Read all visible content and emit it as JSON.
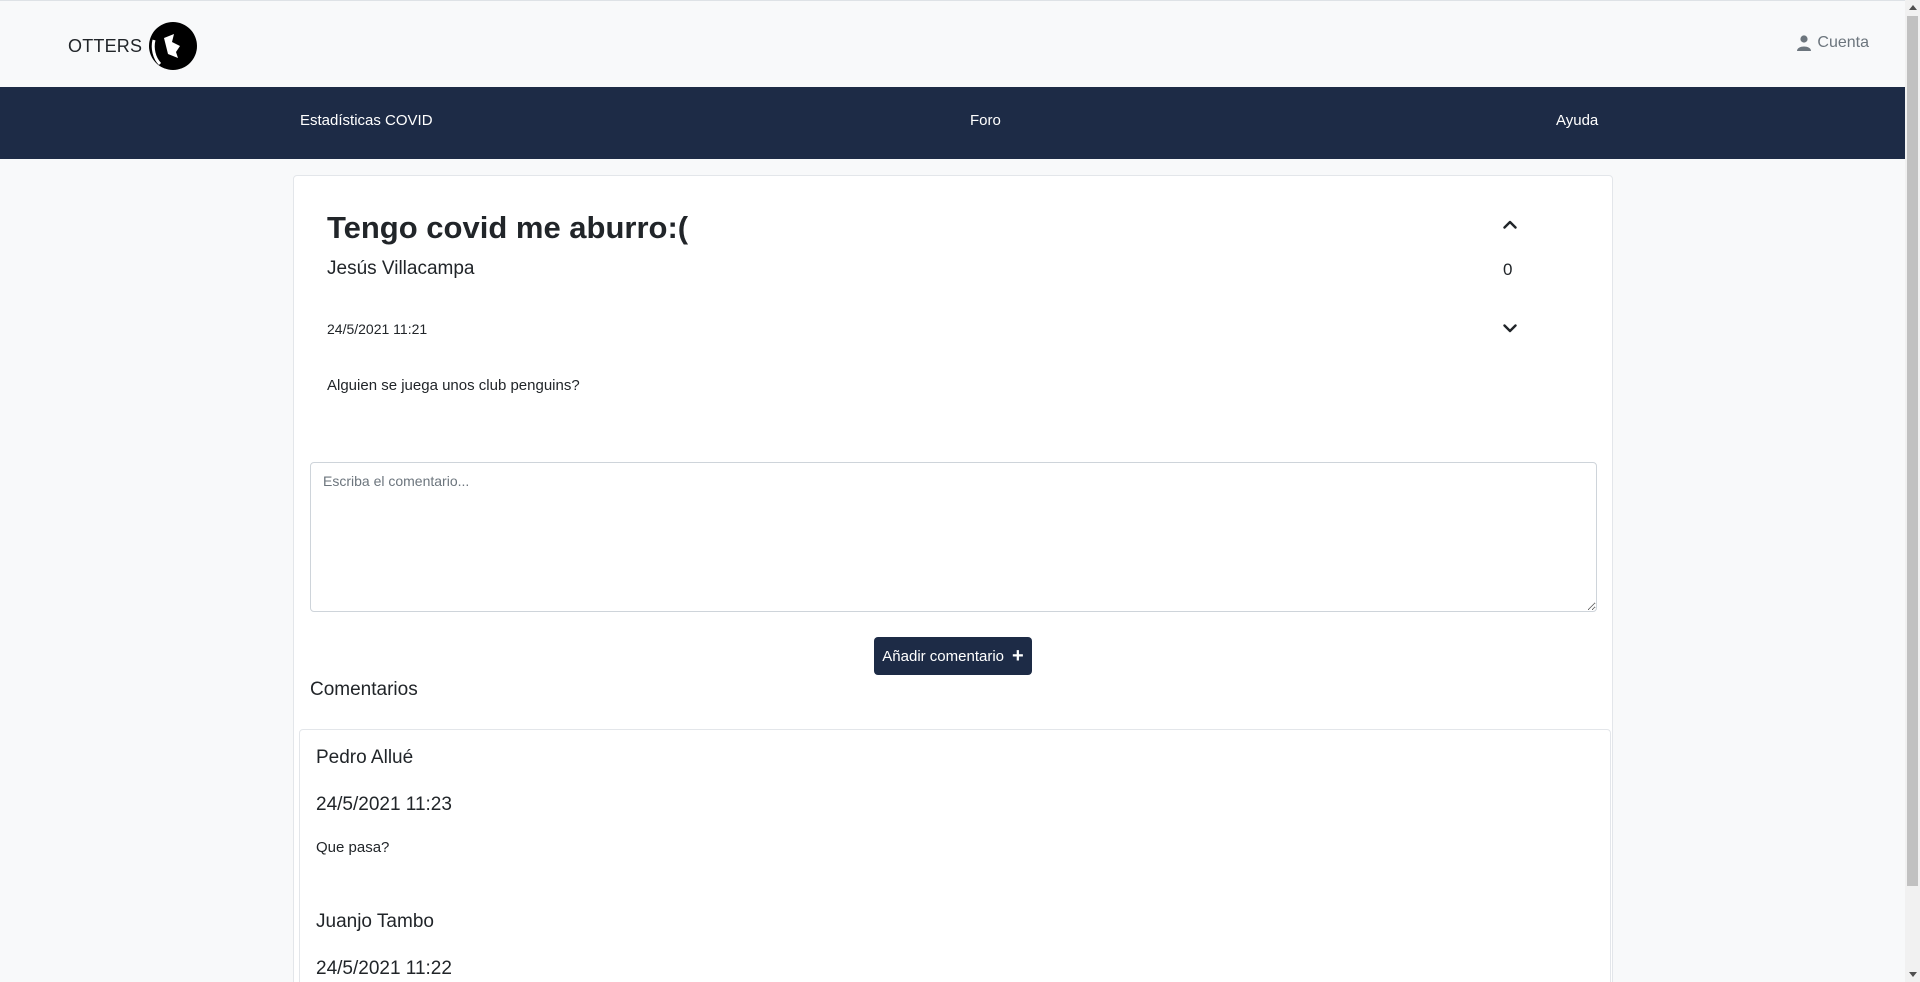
{
  "header": {
    "brand": "OTTERS",
    "account_label": "Cuenta"
  },
  "nav": {
    "items": [
      {
        "label": "Estadísticas COVID"
      },
      {
        "label": "Foro"
      },
      {
        "label": "Ayuda"
      }
    ]
  },
  "post": {
    "title": "Tengo covid me aburro:(",
    "author": "Jesús Villacampa",
    "date": "24/5/2021 11:21",
    "body": "Alguien se juega unos club penguins?",
    "votes": "0"
  },
  "comment_form": {
    "placeholder": "Escriba el comentario...",
    "value": "",
    "submit_label": "Añadir comentario"
  },
  "comments": {
    "heading": "Comentarios",
    "items": [
      {
        "author": "Pedro Allué",
        "date": "24/5/2021 11:23",
        "text": "Que pasa?"
      },
      {
        "author": "Juanjo Tambo",
        "date": "24/5/2021 11:22",
        "text": ""
      }
    ]
  },
  "colors": {
    "navbar": "#1d2b46",
    "button": "#1d2b46",
    "background": "#f8f9fa"
  }
}
